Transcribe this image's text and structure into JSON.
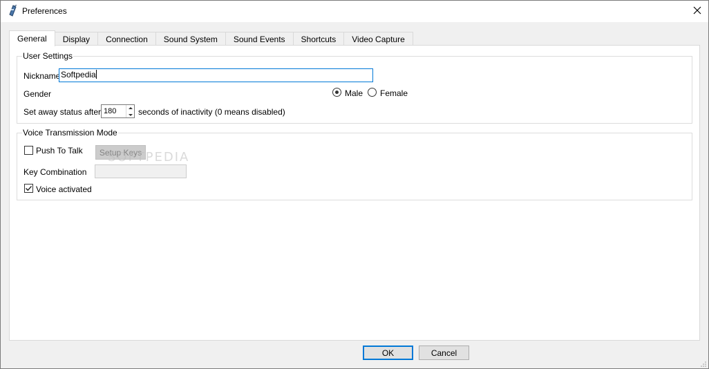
{
  "window": {
    "title": "Preferences"
  },
  "tabs": [
    {
      "label": "General",
      "active": true
    },
    {
      "label": "Display",
      "active": false
    },
    {
      "label": "Connection",
      "active": false
    },
    {
      "label": "Sound System",
      "active": false
    },
    {
      "label": "Sound Events",
      "active": false
    },
    {
      "label": "Shortcuts",
      "active": false
    },
    {
      "label": "Video Capture",
      "active": false
    }
  ],
  "user_settings": {
    "group_label": "User Settings",
    "nickname_label": "Nickname",
    "nickname_value": "Softpedia",
    "gender_label": "Gender",
    "gender_options": [
      {
        "label": "Male",
        "checked": true
      },
      {
        "label": "Female",
        "checked": false
      }
    ],
    "away_label": "Set away status after",
    "away_value": "180",
    "away_suffix": "seconds of inactivity (0 means disabled)"
  },
  "voice": {
    "group_label": "Voice Transmission Mode",
    "push_to_talk_label": "Push To Talk",
    "push_to_talk_checked": false,
    "setup_keys_label": "Setup Keys",
    "key_combination_label": "Key Combination",
    "key_combination_value": "",
    "voice_activated_label": "Voice activated",
    "voice_activated_checked": true
  },
  "watermark": "SOFTPEDIA",
  "footer": {
    "ok_label": "OK",
    "cancel_label": "Cancel"
  },
  "colors": {
    "accent": "#0078d7",
    "window_bg": "#f0f0f0",
    "panel_bg": "#ffffff"
  },
  "icons": {
    "app": "teamtalk-app-icon",
    "close": "close-icon",
    "check": "checkmark-icon",
    "resize": "resize-grip-icon"
  }
}
